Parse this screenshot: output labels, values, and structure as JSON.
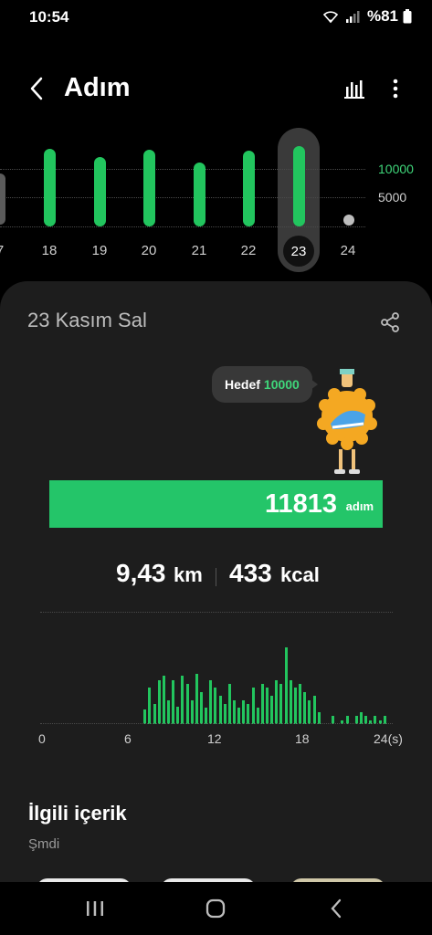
{
  "status_bar": {
    "time": "10:54",
    "battery_text": "%81",
    "icons": [
      "wifi-icon",
      "signal-icon",
      "battery-icon"
    ]
  },
  "header": {
    "title": "Adım",
    "back_icon": "back-arrow-icon",
    "chart_icon": "bar-chart-icon",
    "more_icon": "more-vertical-icon"
  },
  "weekly_chart": {
    "y_labels": [
      "10000",
      "5000"
    ],
    "days": [
      {
        "label": "7"
      },
      {
        "label": "18"
      },
      {
        "label": "19"
      },
      {
        "label": "20"
      },
      {
        "label": "21"
      },
      {
        "label": "22"
      },
      {
        "label": "23",
        "selected": true
      },
      {
        "label": "24"
      }
    ],
    "steps": [
      null,
      11200,
      9800,
      11100,
      8900,
      10900,
      11813,
      0
    ],
    "goal": 10000,
    "colors": {
      "bar": "#22c55e",
      "goal_label": "#3fd67a"
    }
  },
  "detail": {
    "date": "23 Kasım Sal",
    "share_icon": "share-icon",
    "goal_label": "Hedef",
    "goal_value": "10000",
    "steps_value": "11813",
    "steps_unit": "adım",
    "distance_value": "9,43",
    "distance_unit": "km",
    "calories_value": "433",
    "calories_unit": "kcal",
    "accent_color": "#24c569"
  },
  "hourly_chart": {
    "x_labels": [
      "0",
      "6",
      "12",
      "18",
      "24(s)"
    ],
    "x_range": [
      0,
      24
    ],
    "values": [
      0,
      0,
      0,
      0,
      0,
      0,
      0,
      0,
      0,
      0,
      0,
      0,
      0,
      0,
      0,
      0,
      0,
      0,
      0,
      0,
      0,
      0,
      18,
      45,
      25,
      55,
      60,
      30,
      55,
      22,
      60,
      50,
      30,
      62,
      40,
      20,
      55,
      45,
      35,
      25,
      50,
      30,
      20,
      30,
      25,
      45,
      20,
      50,
      45,
      35,
      55,
      50,
      95,
      55,
      45,
      50,
      40,
      30,
      35,
      15,
      0,
      0,
      10,
      0,
      5,
      10,
      0,
      10,
      15,
      10,
      5,
      10,
      5,
      10,
      0
    ],
    "max": 100
  },
  "related": {
    "title": "İlgili içerik",
    "subtitle": "Şmdi"
  },
  "navbar": {
    "icons": [
      "recent-apps-icon",
      "home-icon",
      "back-icon"
    ]
  }
}
